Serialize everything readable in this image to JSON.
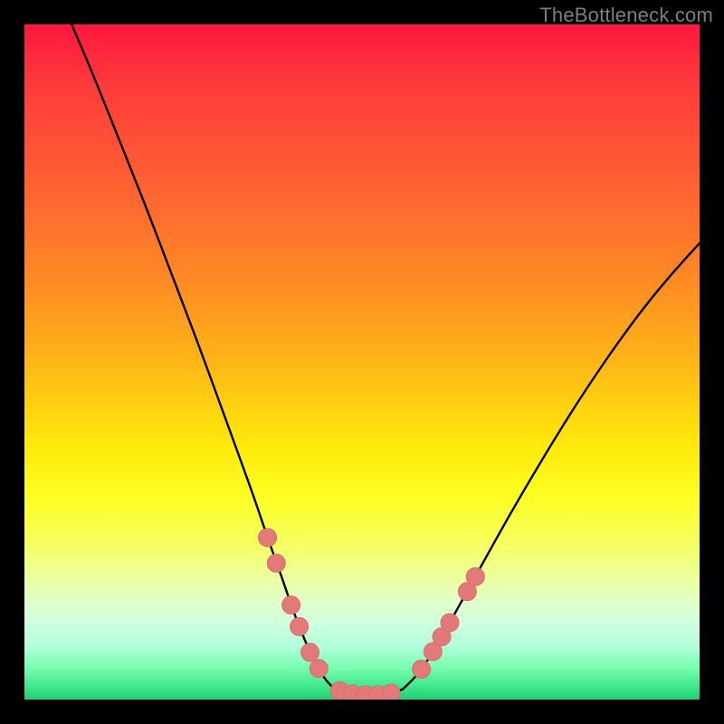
{
  "watermark": "TheBottleneck.com",
  "colors": {
    "curve": "#000000",
    "marker_fill": "#e37a7a",
    "marker_stroke": "#d86c6c"
  },
  "chart_data": {
    "type": "line",
    "title": "",
    "xlabel": "",
    "ylabel": "",
    "xlim": [
      0,
      100
    ],
    "ylim": [
      0,
      100
    ],
    "grid": false,
    "legend": false,
    "series": [
      {
        "name": "curve-left",
        "x": [
          7,
          10,
          14,
          18,
          22,
          26,
          30,
          34,
          36,
          38,
          39.5,
          41,
          43,
          44.5,
          46
        ],
        "y": [
          100,
          93,
          83,
          73,
          62.5,
          52,
          41,
          30,
          24,
          18.5,
          14,
          10,
          5.5,
          3,
          1.5
        ]
      },
      {
        "name": "curve-floor",
        "x": [
          46,
          48,
          50,
          52,
          54,
          56
        ],
        "y": [
          1.5,
          0.9,
          0.7,
          0.7,
          0.9,
          1.5
        ]
      },
      {
        "name": "curve-right",
        "x": [
          56,
          58,
          60,
          62,
          64,
          68,
          72,
          76,
          80,
          84,
          88,
          92,
          96,
          100
        ],
        "y": [
          1.5,
          3.4,
          6.2,
          9.6,
          13.2,
          20.4,
          27.6,
          34.4,
          41.0,
          47.2,
          53.0,
          58.4,
          63.2,
          67.6
        ]
      }
    ],
    "markers": {
      "name": "highlight-dots",
      "points": [
        {
          "x": 36.0,
          "y": 24.0
        },
        {
          "x": 37.3,
          "y": 20.2
        },
        {
          "x": 39.5,
          "y": 14.0
        },
        {
          "x": 40.7,
          "y": 10.8
        },
        {
          "x": 42.3,
          "y": 7.0
        },
        {
          "x": 43.6,
          "y": 4.6
        },
        {
          "x": 46.7,
          "y": 1.3
        },
        {
          "x": 48.6,
          "y": 0.85
        },
        {
          "x": 50.5,
          "y": 0.7
        },
        {
          "x": 52.4,
          "y": 0.7
        },
        {
          "x": 54.3,
          "y": 0.95
        },
        {
          "x": 58.8,
          "y": 4.5
        },
        {
          "x": 60.5,
          "y": 7.1
        },
        {
          "x": 61.8,
          "y": 9.3
        },
        {
          "x": 63.0,
          "y": 11.4
        },
        {
          "x": 65.6,
          "y": 16.0
        },
        {
          "x": 66.8,
          "y": 18.2
        }
      ]
    }
  }
}
